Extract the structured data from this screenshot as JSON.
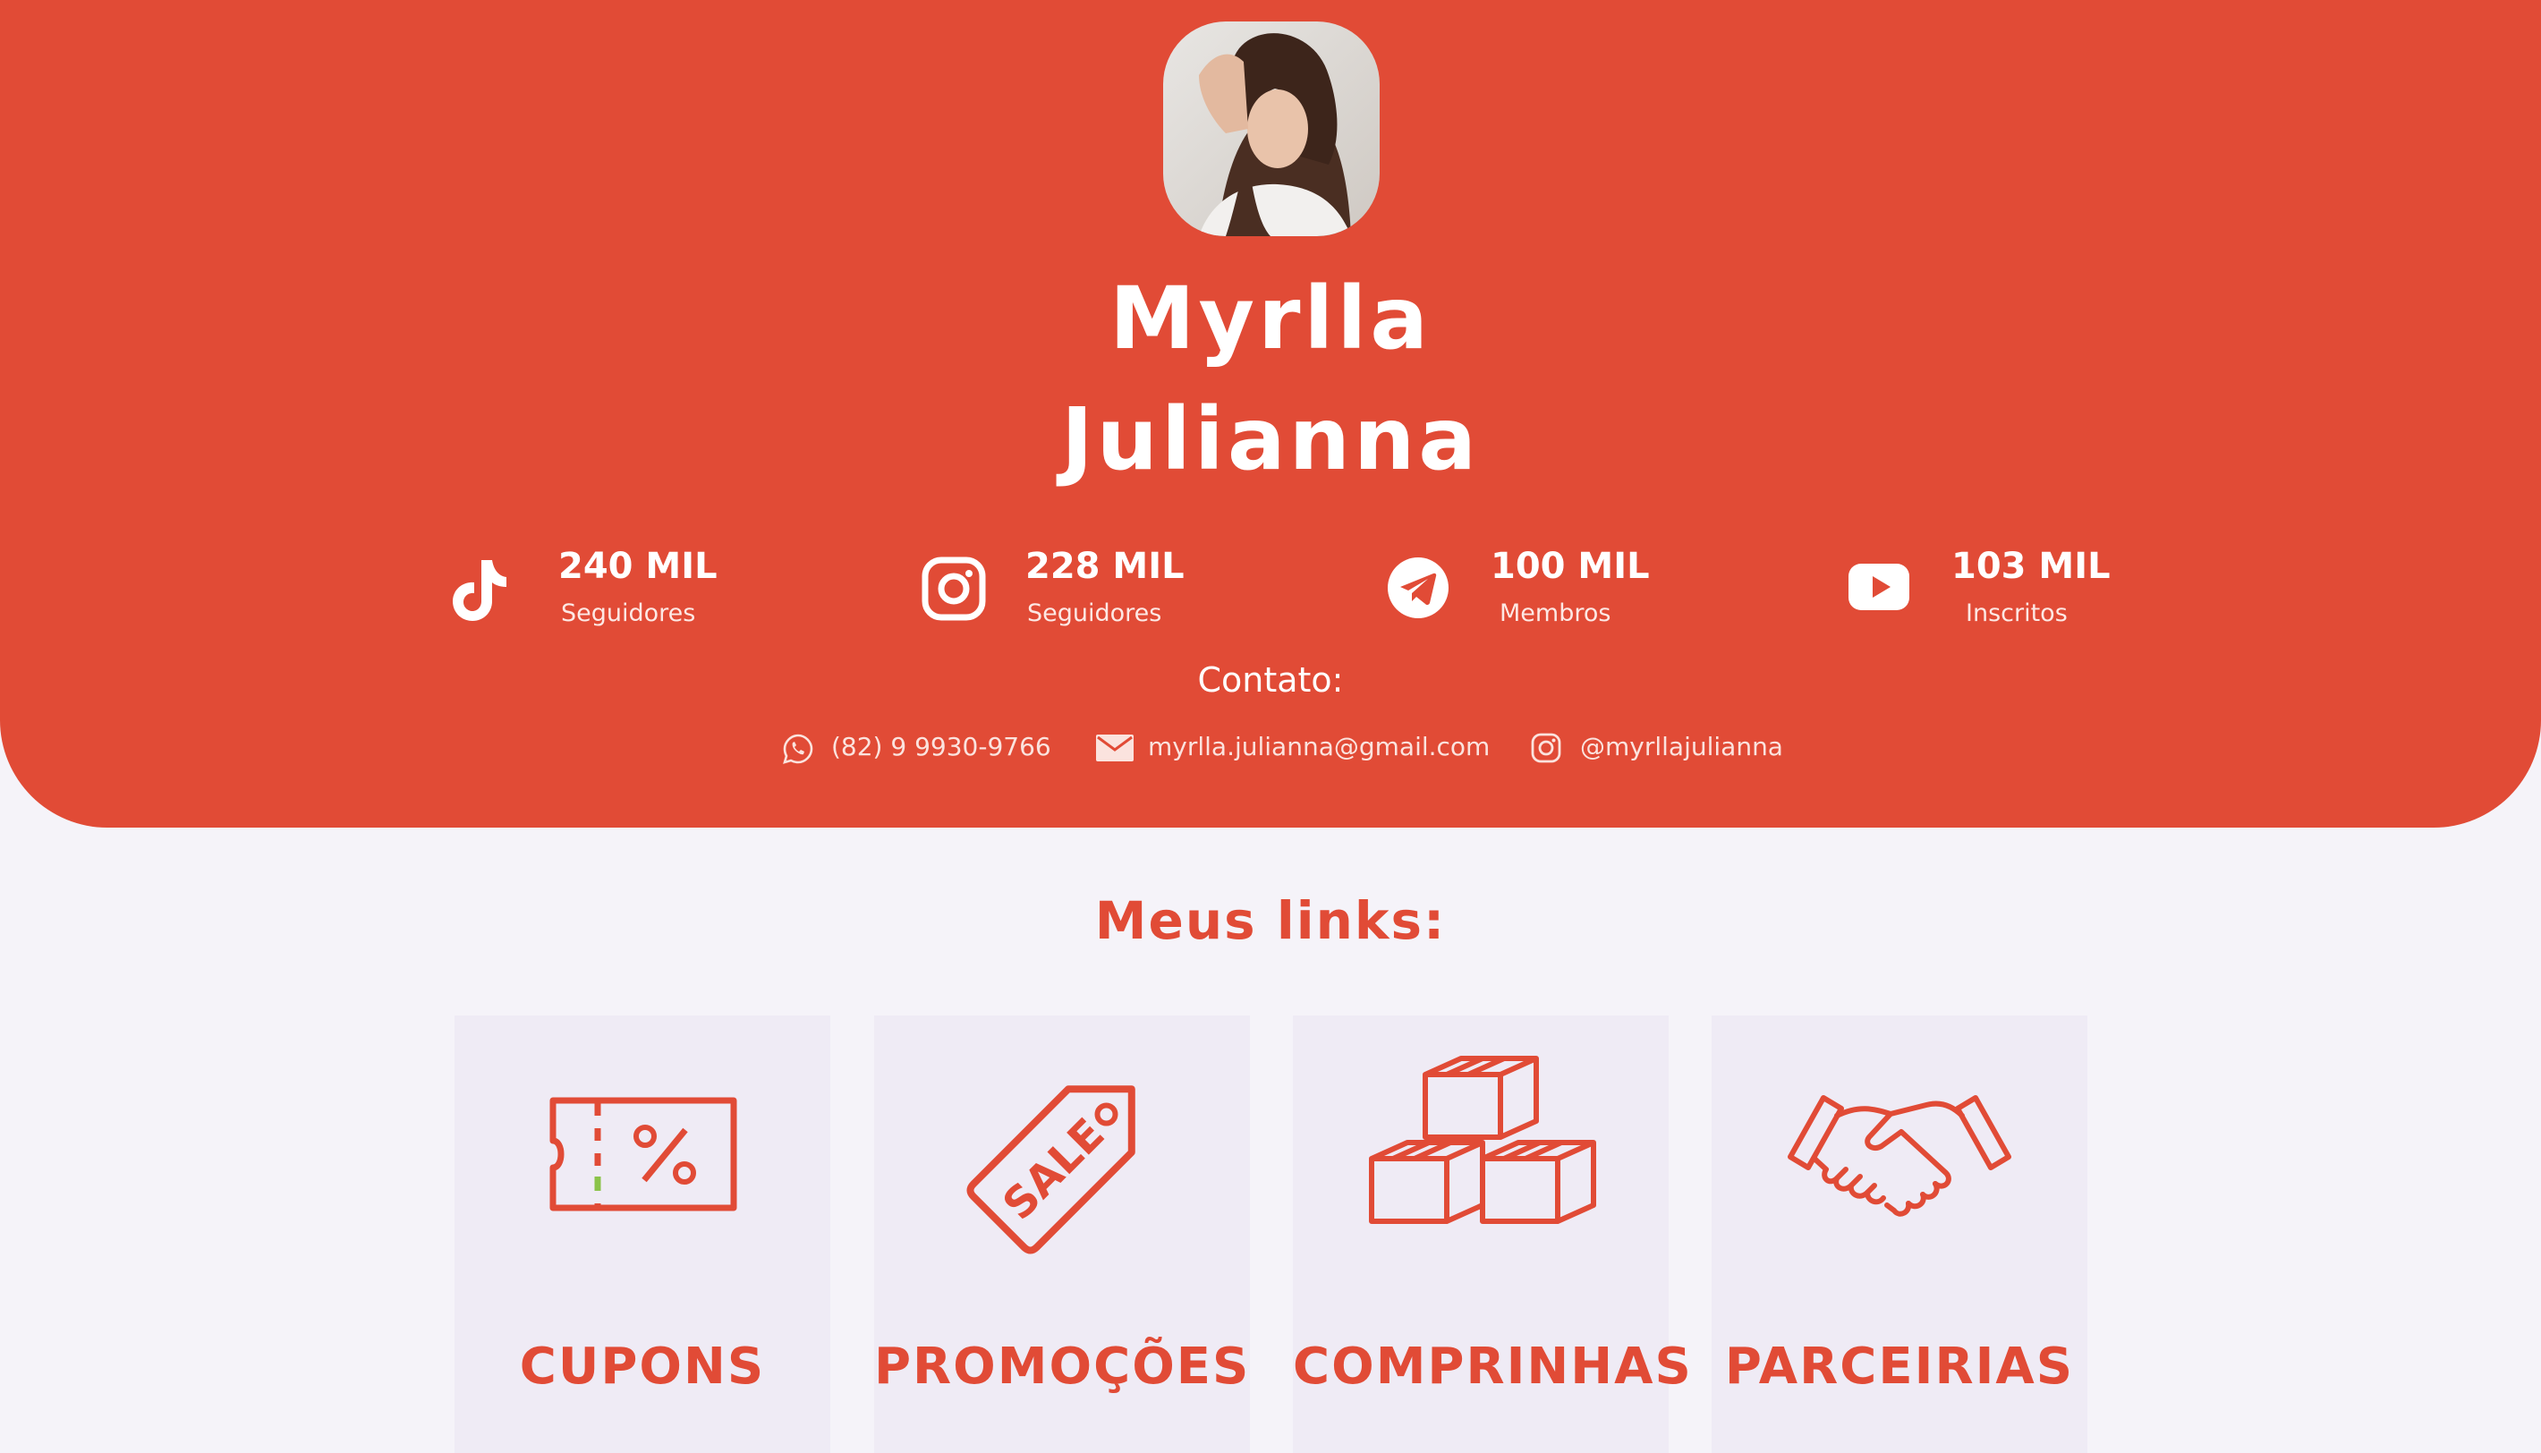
{
  "profile": {
    "first_name": "Myrlla",
    "last_name": "Julianna",
    "accent_color": "#e14b36"
  },
  "stats": [
    {
      "platform": "tiktok-icon",
      "value": "240 MIL",
      "label": "Seguidores"
    },
    {
      "platform": "instagram-icon",
      "value": "228 MIL",
      "label": "Seguidores"
    },
    {
      "platform": "telegram-icon",
      "value": "100 MIL",
      "label": "Membros"
    },
    {
      "platform": "youtube-icon",
      "value": "103 MIL",
      "label": "Inscritos"
    }
  ],
  "contact": {
    "title": "Contato:",
    "phone": "(82) 9 9930-9766",
    "email": "myrlla.julianna@gmail.com",
    "instagram": "@myrllajulianna"
  },
  "links": {
    "title": "Meus links:",
    "items": [
      {
        "label": "CUPONS",
        "icon": "coupon-icon"
      },
      {
        "label": "PROMOÇÕES",
        "icon": "sale-tag-icon"
      },
      {
        "label": "COMPRINHAS",
        "icon": "boxes-icon"
      },
      {
        "label": "PARCEIRIAS",
        "icon": "handshake-icon"
      }
    ]
  }
}
